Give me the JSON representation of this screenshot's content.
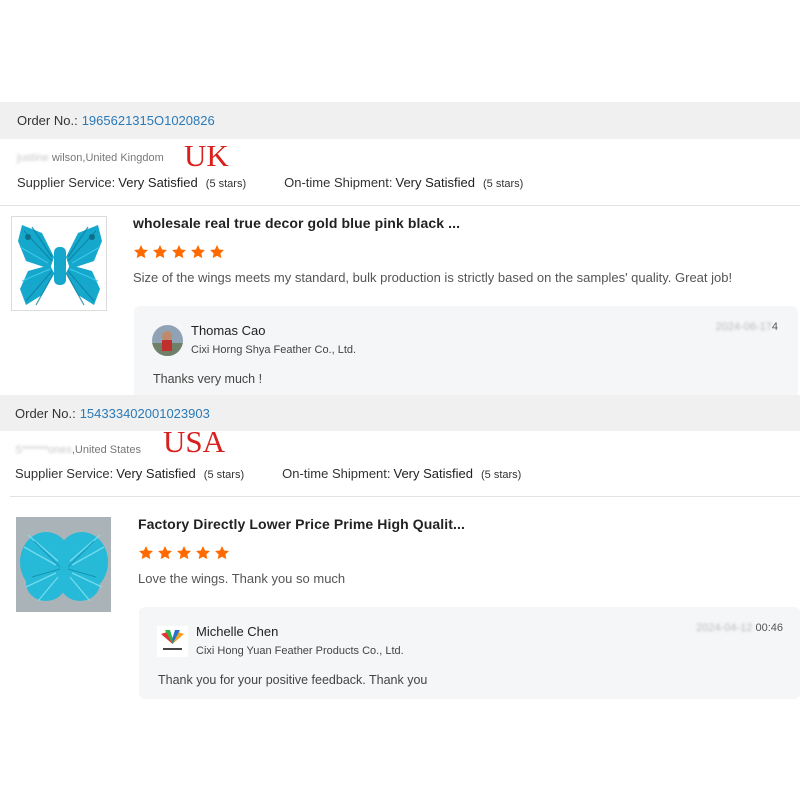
{
  "reviews": [
    {
      "order_label": "Order No.:",
      "order_number": "1965621315O1020826",
      "buyer_blurred": "justine",
      "buyer_visible": " wilson,United Kingdom",
      "country_tag": "UK",
      "supplier_service_label": "Supplier Service:",
      "supplier_service_value": "Very Satisfied",
      "supplier_service_stars": "(5 stars)",
      "shipment_label": "On-time Shipment:",
      "shipment_value": "Very Satisfied",
      "shipment_stars": "(5 stars)",
      "product_title": "wholesale real true decor gold blue pink black ...",
      "rating": 5,
      "review_text": "Size of the wings meets my standard, bulk production is strictly based on the  samples' quality. Great job!",
      "reply": {
        "name": "Thomas Cao",
        "company": "Cixi Horng Shya Feather Co., Ltd.",
        "date_blurred": "2024-06-17",
        "date_visible": "4",
        "text": "Thanks very much !"
      }
    },
    {
      "order_label": "Order No.:",
      "order_number": "154333402001023903",
      "buyer_blurred": "S******ones",
      "buyer_visible": ",United States",
      "country_tag": "USA",
      "supplier_service_label": "Supplier Service:",
      "supplier_service_value": "Very Satisfied",
      "supplier_service_stars": "(5 stars)",
      "shipment_label": "On-time Shipment:",
      "shipment_value": "Very Satisfied",
      "shipment_stars": "(5 stars)",
      "product_title": "Factory Directly Lower Price Prime High Qualit...",
      "rating": 5,
      "review_text": "Love the wings.  Thank you so much",
      "reply": {
        "name": "Michelle Chen",
        "company": "Cixi Hong Yuan Feather Products Co., Ltd.",
        "date_blurred": "2024-04-12",
        "date_visible": " 00:46",
        "text": "Thank you for your positive feedback. Thank you"
      }
    }
  ],
  "colors": {
    "order_link": "#2a7ab8",
    "country_tag": "#d8201e",
    "star": "#ff6a00",
    "feather": "#1fb6d6"
  },
  "icons": {
    "star": "star-icon",
    "avatar1": "user-photo-avatar",
    "avatar2": "hongyuan-logo-avatar"
  }
}
